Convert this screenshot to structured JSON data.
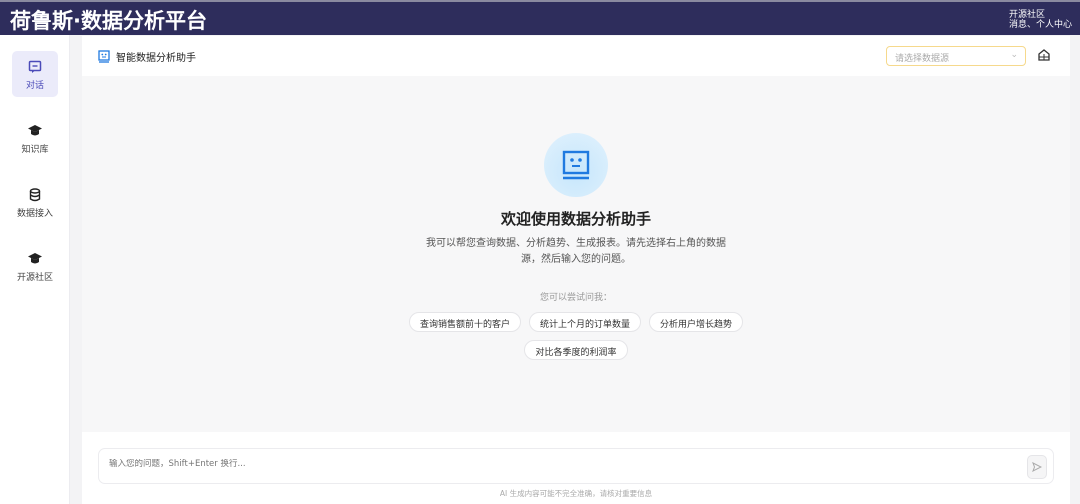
{
  "topbar": {
    "brand": "荷鲁斯·数据分析平台",
    "link_community": "开源社区",
    "link_user": "消息、个人中心"
  },
  "sidebar": {
    "items": [
      {
        "label": "对话",
        "icon": "chat-icon"
      },
      {
        "label": "知识库",
        "icon": "graduation-cap-icon"
      },
      {
        "label": "数据接入",
        "icon": "database-icon"
      },
      {
        "label": "开源社区",
        "icon": "graduation-cap-icon"
      }
    ]
  },
  "header": {
    "title": "智能数据分析助手",
    "datasource_placeholder": "请选择数据源"
  },
  "welcome": {
    "title": "欢迎使用数据分析助手",
    "description": "我可以帮您查询数据、分析趋势、生成报表。请先选择右上角的数据源，然后输入您的问题。",
    "try_label": "您可以尝试问我：",
    "suggestions": [
      "查询销售额前十的客户",
      "统计上个月的订单数量",
      "分析用户增长趋势",
      "对比各季度的利润率"
    ]
  },
  "composer": {
    "placeholder": "输入您的问题，Shift+Enter 换行...",
    "disclaimer": "AI 生成内容可能不完全准确，请核对重要信息"
  },
  "colors": {
    "topbar": "#2e2d5c",
    "accent": "#4a4ab8",
    "robot": "#1f7ae0"
  }
}
